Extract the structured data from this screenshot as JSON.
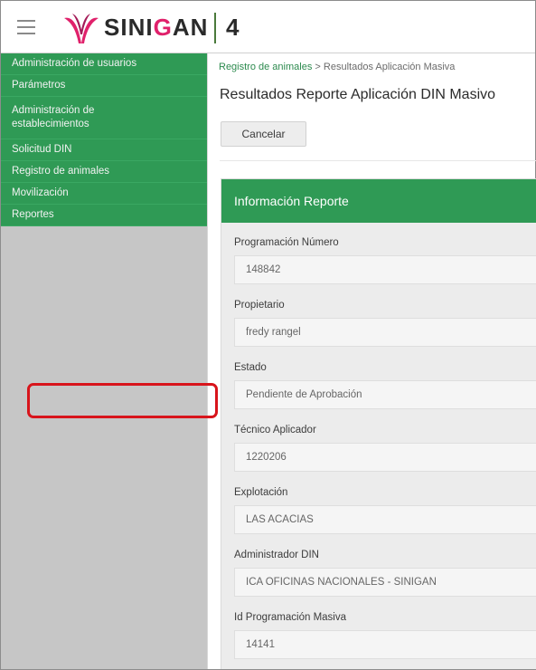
{
  "app": {
    "brand_left": "SINI",
    "brand_accent": "G",
    "brand_right": "AN",
    "version": "4",
    "brand_color": "#2f9a55",
    "accent_color": "#e0216b"
  },
  "sidebar": {
    "items": [
      {
        "label": "Administración de usuarios"
      },
      {
        "label": "Parámetros"
      },
      {
        "label": "Administración de establecimientos"
      },
      {
        "label": "Solicitud DIN"
      },
      {
        "label": "Registro de animales"
      },
      {
        "label": "Movilización"
      },
      {
        "label": "Reportes"
      }
    ]
  },
  "breadcrumb": {
    "link": "Registro de animales",
    "separator": ">",
    "current": "Resultados Aplicación Masiva"
  },
  "page": {
    "title": "Resultados Reporte Aplicación DIN Masivo",
    "cancel_label": "Cancelar"
  },
  "card": {
    "title": "Información Reporte",
    "fields": [
      {
        "label": "Programación Número",
        "value": "148842"
      },
      {
        "label": "Propietario",
        "value": "fredy rangel"
      },
      {
        "label": "Estado",
        "value": "Pendiente de Aprobación"
      },
      {
        "label": "Técnico Aplicador",
        "value": "1220206"
      },
      {
        "label": "Explotación",
        "value": "LAS ACACIAS"
      },
      {
        "label": "Administrador DIN",
        "value": "ICA OFICINAS NACIONALES - SINIGAN"
      },
      {
        "label": "Id Programación Masiva",
        "value": "14141"
      }
    ]
  }
}
